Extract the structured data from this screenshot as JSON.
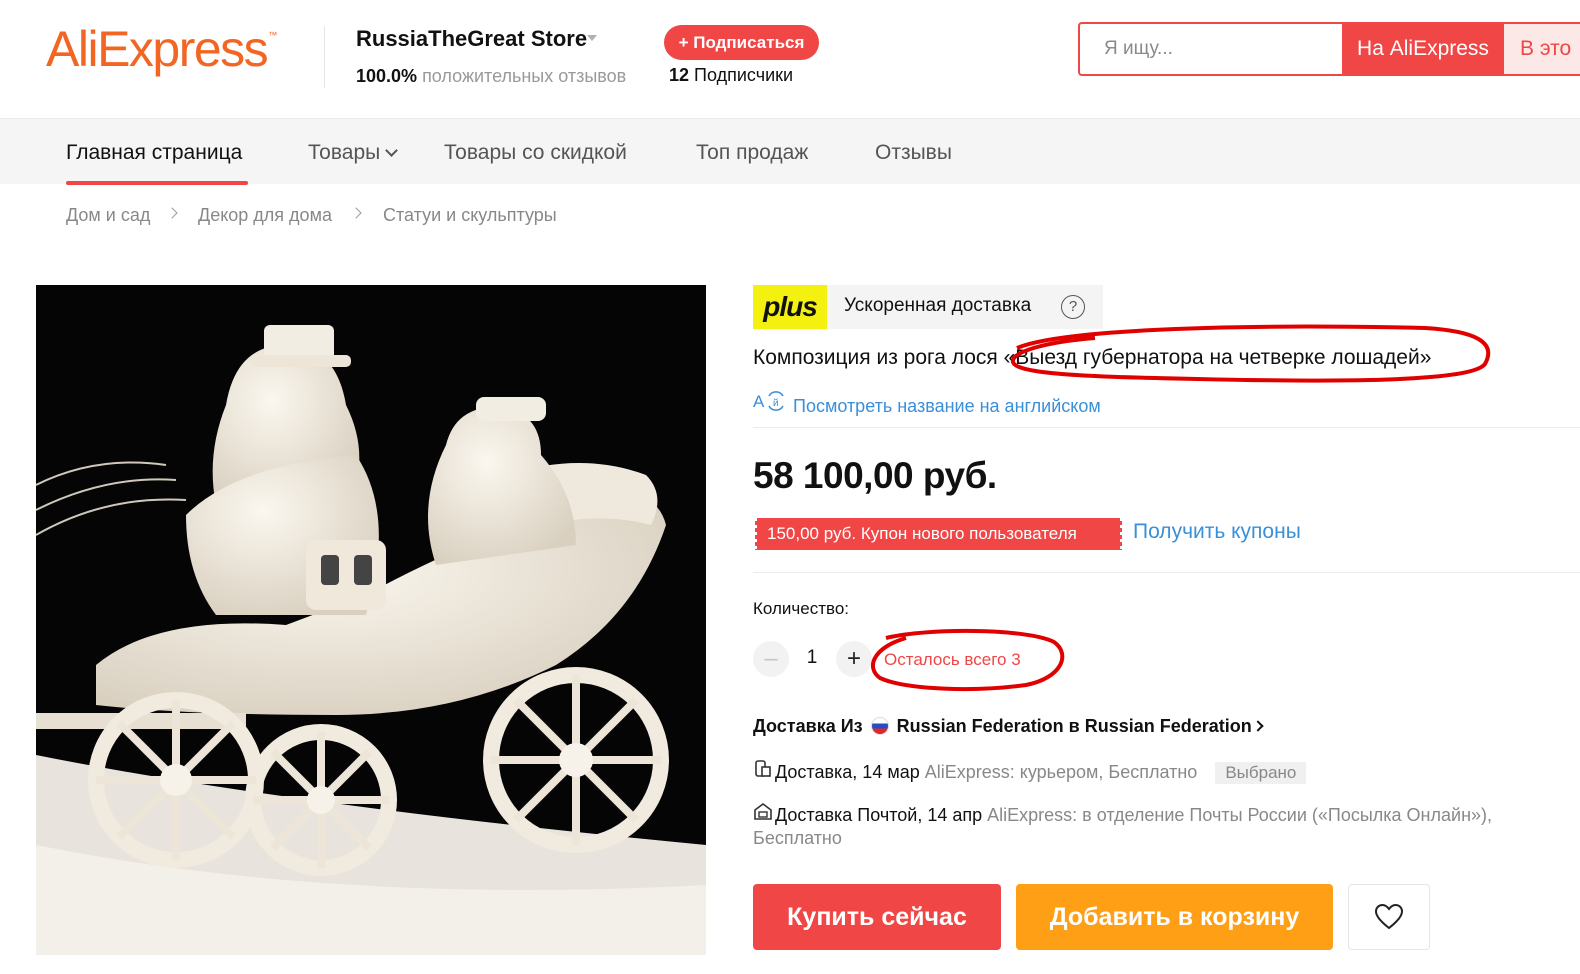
{
  "header": {
    "logo_text": "AliExpress",
    "logo_tm": "™",
    "store_name": "RussiaTheGreat Store",
    "store_rating_value": "100.0%",
    "store_rating_label": " положительных отзывов",
    "subscribe_label": "+ Подписаться",
    "followers_count": "12",
    "followers_label": " Подписчики",
    "search_placeholder": "Я ищу...",
    "search_btn_aliexpress": "На AliExpress",
    "search_btn_store": "В это"
  },
  "nav": {
    "items": [
      "Главная страница",
      "Товары",
      "Товары со скидкой",
      "Топ продаж",
      "Отзывы"
    ],
    "active_index": 0
  },
  "breadcrumb": [
    "Дом и сад",
    "Декор для дома",
    "Статуи и скульптуры"
  ],
  "product": {
    "plus_logo": "plus",
    "plus_text": "Ускоренная доставка",
    "help_symbol": "?",
    "title": "Композиция из рога лося «Выезд губернатора на четверке лошадей»",
    "translate_link": "Посмотреть название на английском",
    "price": "58 100,00 руб.",
    "coupon_tag": "150,00 руб. Купон нового пользователя",
    "coupon_link": "Получить купоны",
    "quantity_label": "Количество:",
    "quantity_minus": "–",
    "quantity_value": "1",
    "quantity_plus": "+",
    "quantity_left": "Осталось всего 3",
    "delivery_head_prefix": "Доставка Из",
    "delivery_head_rest": "Russian Federation в Russian Federation",
    "shipping": [
      {
        "label": "Доставка, 14 мар",
        "method": " AliExpress: курьером, Бесплатно",
        "tag": "Выбрано",
        "icon": "courier-icon"
      },
      {
        "label": "Доставка Почтой, 14 апр",
        "method": " AliExpress: в отделение Почты России («Посылка Онлайн»),",
        "continuation": "Бесплатно",
        "icon": "post-office-icon"
      }
    ],
    "buy_now": "Купить сейчас",
    "add_to_cart": "Добавить в корзину"
  },
  "colors": {
    "accent_red": "#f04646",
    "logo_orange": "#f26522",
    "cart_orange": "#fe9f16",
    "link_blue": "#3a8fd9",
    "plus_yellow": "#f4f00f"
  }
}
